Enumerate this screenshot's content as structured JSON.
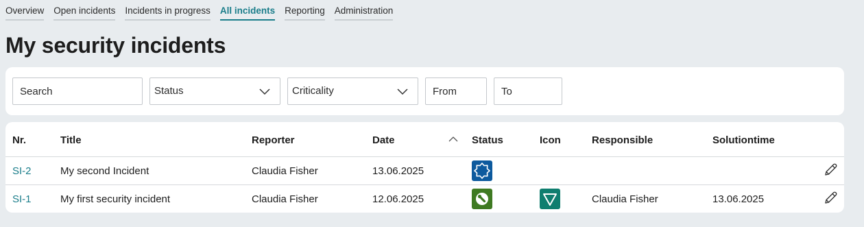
{
  "tabs": [
    {
      "label": "Overview",
      "active": false
    },
    {
      "label": "Open incidents",
      "active": false
    },
    {
      "label": "Incidents in progress",
      "active": false
    },
    {
      "label": "All incidents",
      "active": true
    },
    {
      "label": "Reporting",
      "active": false
    },
    {
      "label": "Administration",
      "active": false
    }
  ],
  "page_title": "My security incidents",
  "filters": {
    "search_placeholder": "Search",
    "status_label": "Status",
    "criticality_label": "Criticality",
    "from_placeholder": "From",
    "to_placeholder": "To"
  },
  "table": {
    "columns": [
      "Nr.",
      "Title",
      "Reporter",
      "Date",
      "Status",
      "Icon",
      "Responsible",
      "Solutiontime"
    ],
    "sort": {
      "column": "Date",
      "direction": "ascending"
    },
    "rows": [
      {
        "nr": "SI-2",
        "title": "My second Incident",
        "reporter": "Claudia Fisher",
        "date": "13.06.2025",
        "status_icon": "gear-icon",
        "status_color": "#0d5a9e",
        "icon": "",
        "icon_color": "",
        "responsible": "",
        "solutiontime": ""
      },
      {
        "nr": "SI-1",
        "title": "My first security incident",
        "reporter": "Claudia Fisher",
        "date": "12.06.2025",
        "status_icon": "wrench-icon",
        "status_color": "#3f7a22",
        "icon": "triangle-down-icon",
        "icon_color": "#0f7e6f",
        "responsible": "Claudia Fisher",
        "solutiontime": "13.06.2025"
      }
    ]
  },
  "colors": {
    "accent": "#1a7d8a",
    "background": "#e8ecef"
  }
}
